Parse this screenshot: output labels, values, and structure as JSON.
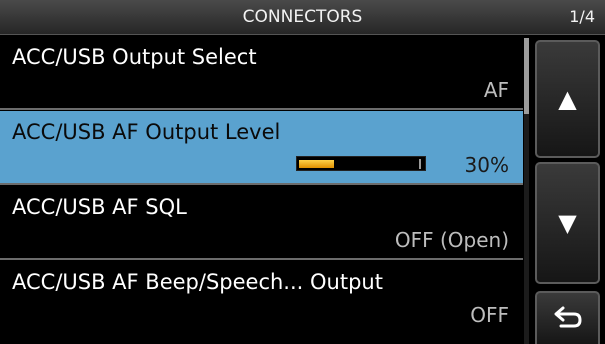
{
  "header": {
    "title": "CONNECTORS",
    "page": "1/4"
  },
  "items": [
    {
      "label": "ACC/USB Output Select",
      "value": "AF"
    },
    {
      "label": "ACC/USB AF Output Level",
      "value": "30%",
      "level": 0.3
    },
    {
      "label": "ACC/USB AF SQL",
      "value": "OFF (Open)"
    },
    {
      "label": "ACC/USB AF Beep/Speech... Output",
      "value": "OFF"
    }
  ],
  "buttons": {
    "up_icon": "up-triangle-icon",
    "down_icon": "down-triangle-icon",
    "back_icon": "return-arrow-icon"
  },
  "colors": {
    "selected_background": "#5aa2cf",
    "level_fill": "#f0b400"
  }
}
